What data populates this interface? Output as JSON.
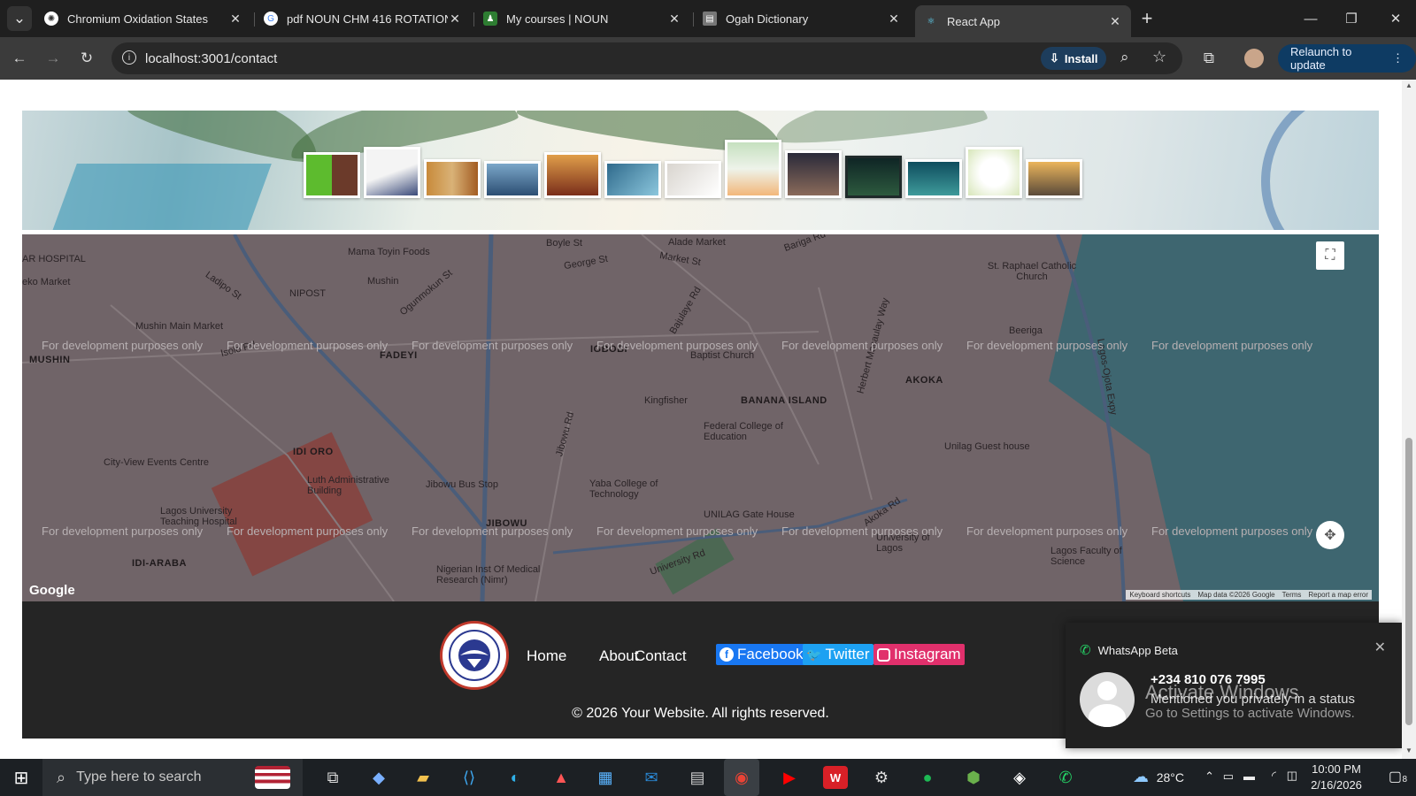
{
  "browser": {
    "tabs": [
      {
        "title": "Chromium Oxidation States",
        "active": false
      },
      {
        "title": "pdf NOUN CHM 416 ROTATION",
        "active": false
      },
      {
        "title": "My courses | NOUN",
        "active": false
      },
      {
        "title": "Ogah Dictionary",
        "active": false
      },
      {
        "title": "React App",
        "active": true
      }
    ],
    "url": "localhost:3001/contact",
    "install_label": "Install",
    "relaunch_label": "Relaunch to update"
  },
  "map": {
    "place_labels": [
      "MUSHIN",
      "FADEYI",
      "IGBOBI",
      "AKOKA",
      "IDI ORO",
      "BANANA ISLAND",
      "JIBOWU",
      "IDI-ARABA"
    ],
    "poi_labels": [
      "Mama Toyin Foods",
      "Alade Market",
      "Mushin",
      "NIPOST",
      "Mushin Main Market",
      "Baptist Church",
      "Kingfisher",
      "Federal College of Education",
      "St. Raphael Catholic Church",
      "Beeriga",
      "City-View Events Centre",
      "Luth Administrative Building",
      "Lagos University Teaching Hospital",
      "Jibowu Bus Stop",
      "Yaba College of Technology",
      "UNILAG Gate House",
      "Unilag Guest house",
      "University of Lagos",
      "Lagos Faculty of Science",
      "Nigerian Inst Of Medical Research (Nimr)",
      "AR HOSPITAL",
      "eko Market"
    ],
    "road_labels": [
      "Bariga Rd",
      "Market St",
      "George St",
      "Boyle St",
      "Ladipo St",
      "Ogunmokun St",
      "Jibowu Rd",
      "Bajulaye Rd",
      "Herbert Macaulay Way",
      "Lagos-Ojota Expy",
      "University Rd",
      "Isolo Rd",
      "Akoka Rd"
    ],
    "dev_watermark": "For development purposes only",
    "footer_links": [
      "Keyboard shortcuts",
      "Map data ©2026 Google",
      "Terms",
      "Report a map error"
    ],
    "google": "Google"
  },
  "footer": {
    "nav": [
      "Home",
      "About",
      "Contact"
    ],
    "social": [
      {
        "label": "Facebook",
        "color": "#1877f2"
      },
      {
        "label": "Twitter",
        "color": "#1da1f2"
      },
      {
        "label": "Instagram",
        "color": "#e1306c"
      }
    ],
    "copyright": "© 2026 Your Website. All rights reserved."
  },
  "whatsapp": {
    "title": "WhatsApp Beta",
    "phone": "+234 810 076 7995",
    "message": "Mentioned you privately in a status"
  },
  "activate_windows": {
    "line1": "Activate Windows",
    "line2": "Go to Settings to activate Windows."
  },
  "taskbar": {
    "search_placeholder": "Type here to search",
    "weather": "28°C",
    "time": "10:00 PM",
    "date": "2/16/2026",
    "notifications": "8"
  }
}
